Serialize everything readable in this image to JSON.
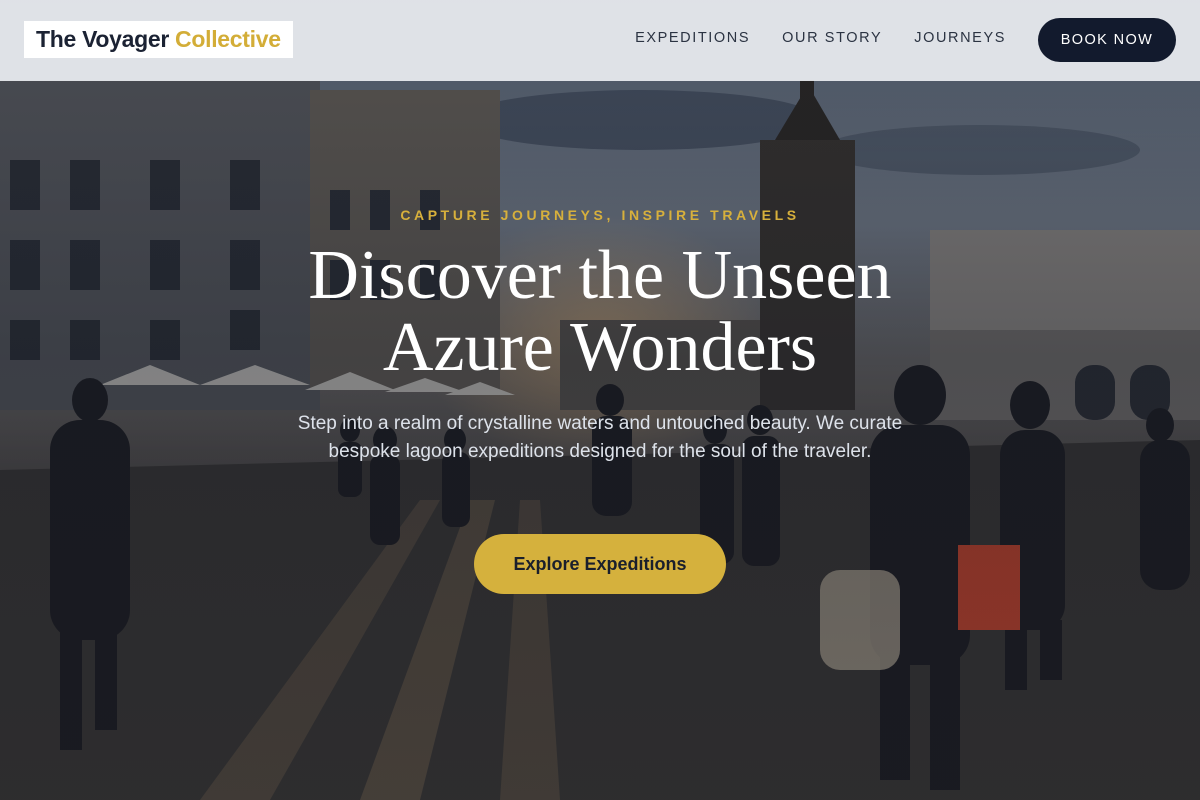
{
  "brand": {
    "name_part1": "The Voyager",
    "name_part2": "Collective"
  },
  "nav": {
    "links": [
      "EXPEDITIONS",
      "OUR STORY",
      "JOURNEYS"
    ],
    "cta_label": "BOOK NOW"
  },
  "hero": {
    "eyebrow": "CAPTURE JOURNEYS, INSPIRE TRAVELS",
    "headline_line1": "Discover the Unseen",
    "headline_line2": "Azure Wonders",
    "subtext": "Step into a realm of crystalline waters and untouched beauty. We curate bespoke lagoon expeditions designed for the soul of the traveler.",
    "cta_label": "Explore Expeditions",
    "background_image": "city-square-crowd-at-dusk-photo"
  },
  "colors": {
    "brand_gold": "#d3ad37",
    "navy": "#121a2d",
    "nav_bg": "#eceef2"
  }
}
